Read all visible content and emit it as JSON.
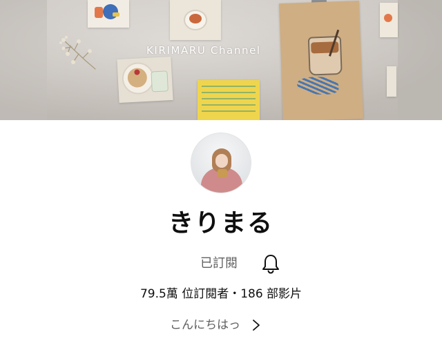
{
  "banner": {
    "title": "KIRIMARU Channel"
  },
  "channel": {
    "name": "きりまる",
    "subscribed_label": "已訂閱",
    "stats": "79.5萬 位訂閱者・186 部影片",
    "about_text": "こんにちはっ"
  },
  "icons": {
    "notification": "bell-icon",
    "about_chevron": "chevron-right-icon"
  },
  "colors": {
    "primary_text": "#0f0f0f",
    "secondary_text": "#606060",
    "background": "#ffffff"
  }
}
